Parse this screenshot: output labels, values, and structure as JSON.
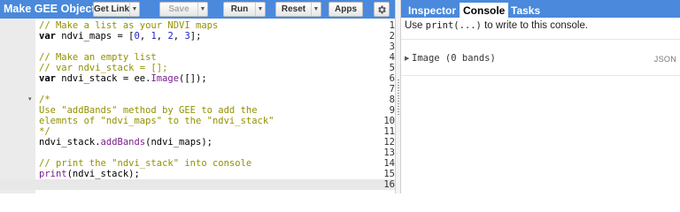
{
  "editor": {
    "script_title": "Make GEE Objects",
    "buttons": {
      "get_link": "Get Link",
      "save": "Save",
      "run": "Run",
      "reset": "Reset",
      "apps": "Apps"
    },
    "lines": [
      {
        "n": "1",
        "tokens": [
          {
            "t": "comment",
            "v": "// Make a list as your NDVI maps"
          }
        ]
      },
      {
        "n": "2",
        "tokens": [
          {
            "t": "keyword",
            "v": "var"
          },
          {
            "t": "plain",
            "v": " ndvi_maps = ["
          },
          {
            "t": "number",
            "v": "0"
          },
          {
            "t": "plain",
            "v": ", "
          },
          {
            "t": "number",
            "v": "1"
          },
          {
            "t": "plain",
            "v": ", "
          },
          {
            "t": "number",
            "v": "2"
          },
          {
            "t": "plain",
            "v": ", "
          },
          {
            "t": "number",
            "v": "3"
          },
          {
            "t": "plain",
            "v": "];"
          }
        ]
      },
      {
        "n": "3",
        "tokens": []
      },
      {
        "n": "4",
        "tokens": [
          {
            "t": "comment",
            "v": "// Make an empty list"
          }
        ]
      },
      {
        "n": "5",
        "tokens": [
          {
            "t": "comment",
            "v": "// var ndvi_stack = [];"
          }
        ]
      },
      {
        "n": "6",
        "tokens": [
          {
            "t": "keyword",
            "v": "var"
          },
          {
            "t": "plain",
            "v": " ndvi_stack = ee."
          },
          {
            "t": "method",
            "v": "Image"
          },
          {
            "t": "plain",
            "v": "([]);"
          }
        ]
      },
      {
        "n": "7",
        "tokens": []
      },
      {
        "n": "8",
        "fold": "▾",
        "tokens": [
          {
            "t": "comment",
            "v": "/*"
          }
        ]
      },
      {
        "n": "9",
        "tokens": [
          {
            "t": "comment",
            "v": "Use \"addBands\" method by GEE to add the"
          }
        ]
      },
      {
        "n": "10",
        "tokens": [
          {
            "t": "comment",
            "v": "elemnts of \"ndvi_maps\" to the \"ndvi_stack\""
          }
        ]
      },
      {
        "n": "11",
        "tokens": [
          {
            "t": "comment",
            "v": "*/"
          }
        ]
      },
      {
        "n": "12",
        "tokens": [
          {
            "t": "plain",
            "v": "ndvi_stack."
          },
          {
            "t": "method",
            "v": "addBands"
          },
          {
            "t": "plain",
            "v": "(ndvi_maps);"
          }
        ]
      },
      {
        "n": "13",
        "tokens": []
      },
      {
        "n": "14",
        "tokens": [
          {
            "t": "comment",
            "v": "// print the \"ndvi_stack\" into console"
          }
        ]
      },
      {
        "n": "15",
        "tokens": [
          {
            "t": "method",
            "v": "print"
          },
          {
            "t": "plain",
            "v": "(ndvi_stack);"
          }
        ]
      },
      {
        "n": "16",
        "tokens": []
      }
    ]
  },
  "panel": {
    "tabs": [
      "Inspector",
      "Console",
      "Tasks"
    ],
    "active_tab": "Console",
    "hint_prefix": "Use ",
    "hint_code": "print(...)",
    "hint_suffix": " to write to this console.",
    "output_text": "Image (0 bands)",
    "json_label": "JSON"
  },
  "colors": {
    "toolbar": "#4a89dc",
    "comment": "#939100",
    "number": "#2321c7",
    "method": "#7a1e8c"
  },
  "icons": [
    "dropdown-arrow-icon",
    "gear-icon",
    "fold-arrow-icon",
    "expand-arrow-icon",
    "splitter-grip-icon"
  ]
}
